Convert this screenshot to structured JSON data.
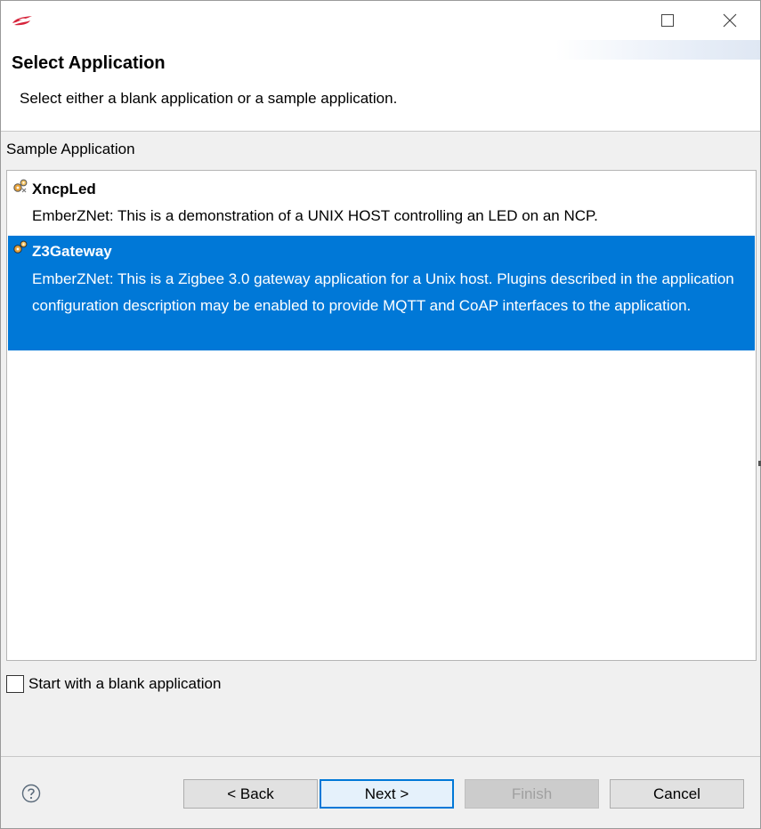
{
  "window": {
    "maximize_glyph": "☐",
    "close_glyph": "✕"
  },
  "header": {
    "title": "Select Application",
    "description": "Select either a blank application or a sample application."
  },
  "section_label": "Sample Application",
  "applications": [
    {
      "name": "XncpLed",
      "description": "EmberZNet: This is a demonstration of a UNIX HOST controlling an LED on an NCP.",
      "selected": false,
      "icon": "gears-icon"
    },
    {
      "name": "Z3Gateway",
      "description": "EmberZNet: This is a Zigbee 3.0 gateway application for a Unix host.  Plugins described in the application configuration description may be enabled to provide MQTT and CoAP interfaces to the application.",
      "selected": true,
      "icon": "gears-icon"
    }
  ],
  "blank_option": {
    "label": "Start with a blank application",
    "checked": false
  },
  "buttons": {
    "back": "< Back",
    "next": "Next >",
    "finish": "Finish",
    "cancel": "Cancel"
  },
  "colors": {
    "selection": "#0078d7",
    "logo": "#d6233a"
  }
}
